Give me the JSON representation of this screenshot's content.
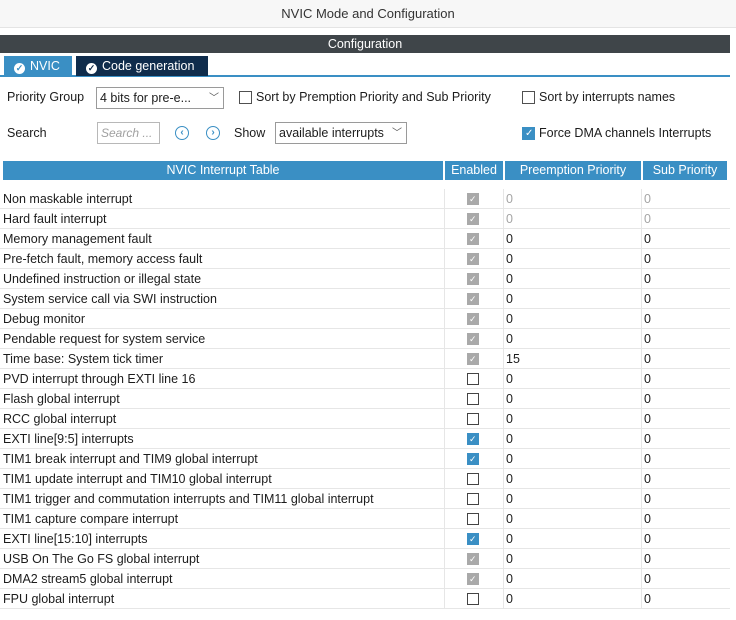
{
  "window": {
    "title": "NVIC Mode and Configuration"
  },
  "section": {
    "title": "Configuration"
  },
  "tabs": [
    {
      "label": "NVIC",
      "active": true
    },
    {
      "label": "Code generation",
      "active": false
    }
  ],
  "controls": {
    "priority_group_label": "Priority Group",
    "priority_group_value": "4 bits for pre-e...",
    "sort_premption_label": "Sort by Premption Priority and Sub Priority",
    "sort_premption_checked": false,
    "sort_names_label": "Sort by interrupts names",
    "sort_names_checked": false,
    "search_label": "Search",
    "search_placeholder": "Search ...",
    "show_label": "Show",
    "show_value": "available interrupts",
    "force_dma_label": "Force DMA channels Interrupts",
    "force_dma_checked": true
  },
  "table": {
    "headers": [
      "NVIC Interrupt Table",
      "Enabled",
      "Preemption Priority",
      "Sub Priority"
    ],
    "rows": [
      {
        "name": "Non maskable interrupt",
        "enabled": "locked",
        "pp": "0",
        "sp": "0",
        "muted": true
      },
      {
        "name": "Hard fault interrupt",
        "enabled": "locked",
        "pp": "0",
        "sp": "0",
        "muted": true
      },
      {
        "name": "Memory management fault",
        "enabled": "locked",
        "pp": "0",
        "sp": "0",
        "muted": false
      },
      {
        "name": "Pre-fetch fault, memory access fault",
        "enabled": "locked",
        "pp": "0",
        "sp": "0",
        "muted": false
      },
      {
        "name": "Undefined instruction or illegal state",
        "enabled": "locked",
        "pp": "0",
        "sp": "0",
        "muted": false
      },
      {
        "name": "System service call via SWI instruction",
        "enabled": "locked",
        "pp": "0",
        "sp": "0",
        "muted": false
      },
      {
        "name": "Debug monitor",
        "enabled": "locked",
        "pp": "0",
        "sp": "0",
        "muted": false
      },
      {
        "name": "Pendable request for system service",
        "enabled": "locked",
        "pp": "0",
        "sp": "0",
        "muted": false
      },
      {
        "name": "Time base: System tick timer",
        "enabled": "locked",
        "pp": "15",
        "sp": "0",
        "muted": false
      },
      {
        "name": "PVD interrupt through EXTI line 16",
        "enabled": "off",
        "pp": "0",
        "sp": "0",
        "muted": false
      },
      {
        "name": "Flash global interrupt",
        "enabled": "off",
        "pp": "0",
        "sp": "0",
        "muted": false
      },
      {
        "name": "RCC global interrupt",
        "enabled": "off",
        "pp": "0",
        "sp": "0",
        "muted": false
      },
      {
        "name": "EXTI line[9:5] interrupts",
        "enabled": "on",
        "pp": "0",
        "sp": "0",
        "muted": false
      },
      {
        "name": "TIM1 break interrupt and TIM9 global interrupt",
        "enabled": "on",
        "pp": "0",
        "sp": "0",
        "muted": false
      },
      {
        "name": "TIM1 update interrupt and TIM10 global interrupt",
        "enabled": "off",
        "pp": "0",
        "sp": "0",
        "muted": false
      },
      {
        "name": "TIM1 trigger and commutation interrupts and TIM11 global interrupt",
        "enabled": "off",
        "pp": "0",
        "sp": "0",
        "muted": false
      },
      {
        "name": "TIM1 capture compare interrupt",
        "enabled": "off",
        "pp": "0",
        "sp": "0",
        "muted": false
      },
      {
        "name": "EXTI line[15:10] interrupts",
        "enabled": "on",
        "pp": "0",
        "sp": "0",
        "muted": false
      },
      {
        "name": "USB On The Go FS global interrupt",
        "enabled": "locked",
        "pp": "0",
        "sp": "0",
        "muted": false
      },
      {
        "name": "DMA2 stream5 global interrupt",
        "enabled": "locked",
        "pp": "0",
        "sp": "0",
        "muted": false
      },
      {
        "name": "FPU global interrupt",
        "enabled": "off",
        "pp": "0",
        "sp": "0",
        "muted": false
      }
    ]
  },
  "colors": {
    "accent": "#3a8fc4",
    "dark_tab": "#0f2c4c",
    "section_bar": "#3f4549",
    "locked_check": "#a9a9a9"
  }
}
